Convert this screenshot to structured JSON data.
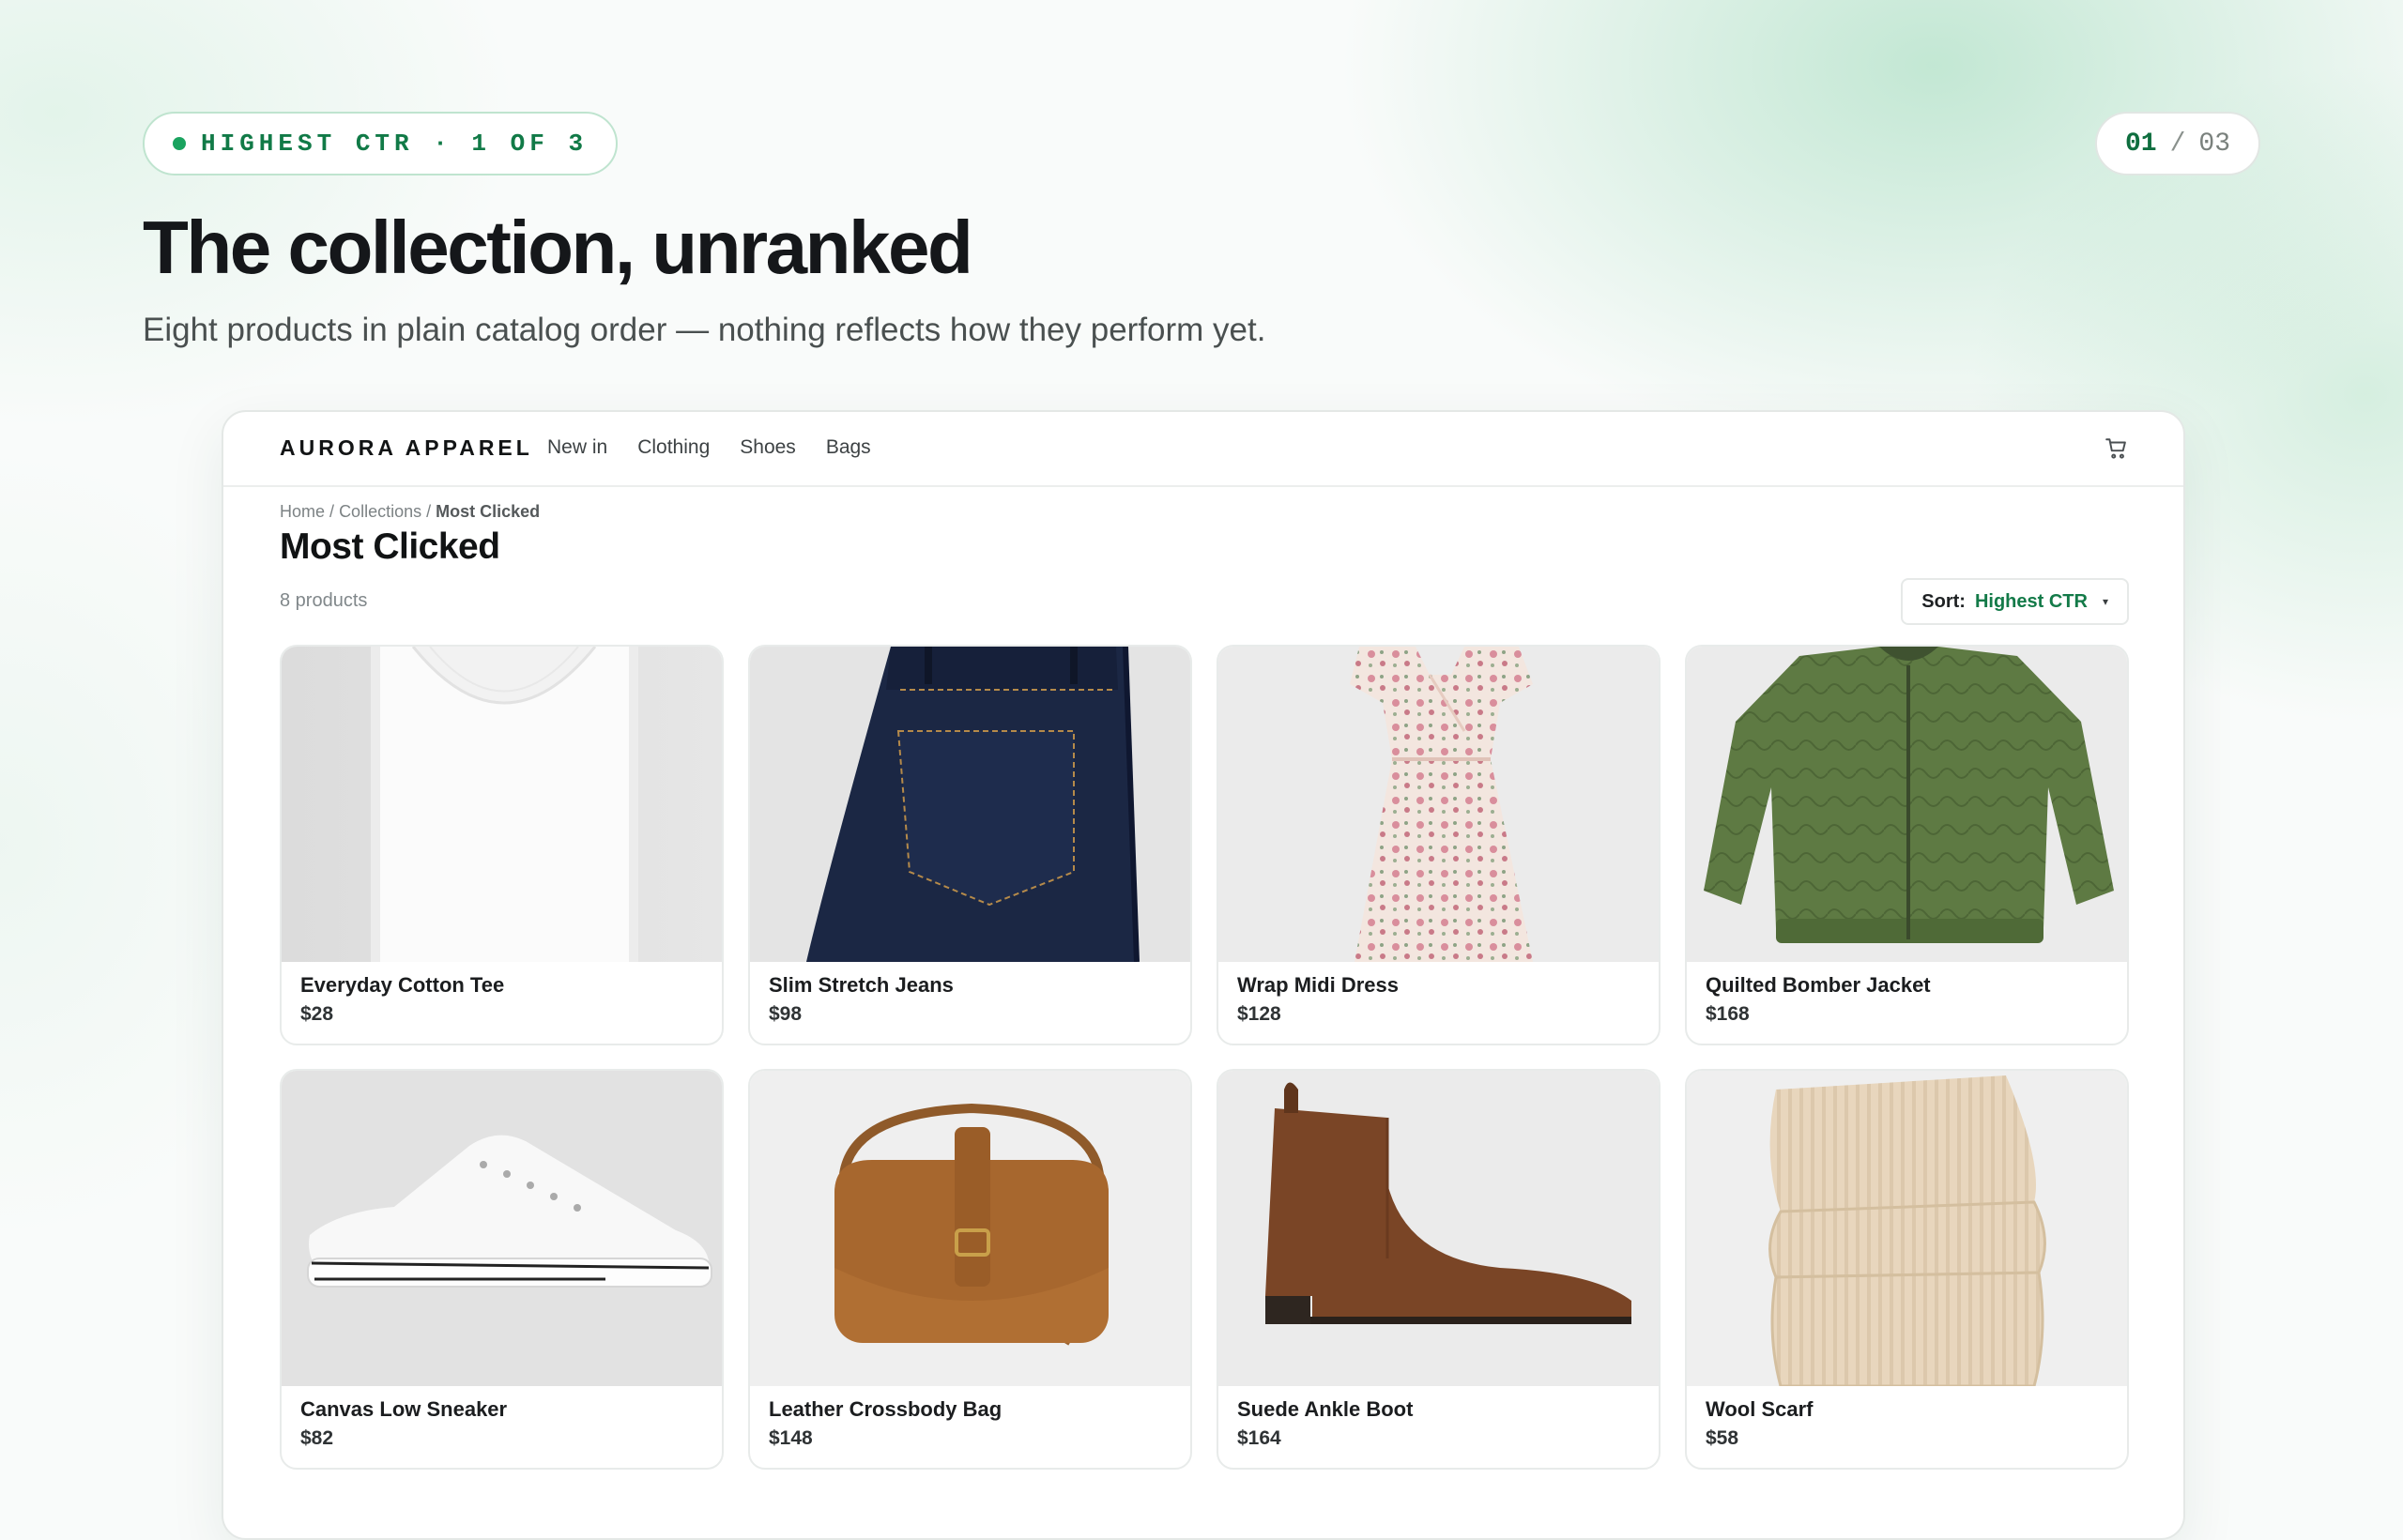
{
  "slide": {
    "pill_label": "HIGHEST CTR · 1 OF 3",
    "counter_current": "01",
    "counter_separator": "/",
    "counter_total": "03",
    "headline": "The collection, unranked",
    "subheadline": "Eight products in plain catalog order — nothing reflects how they perform yet."
  },
  "store": {
    "brand": "AURORA APPAREL",
    "nav": [
      "New in",
      "Clothing",
      "Shoes",
      "Bags"
    ],
    "cart_icon": "cart-icon",
    "breadcrumb": {
      "home": "Home",
      "sep1": "/",
      "collections": "Collections",
      "sep2": "/",
      "current": "Most Clicked"
    },
    "title": "Most Clicked",
    "count": "8 products",
    "sort": {
      "label": "Sort:",
      "value": "Highest CTR",
      "caret": "▾"
    },
    "products": [
      {
        "name": "Everyday Cotton Tee",
        "price": "$28"
      },
      {
        "name": "Slim Stretch Jeans",
        "price": "$98"
      },
      {
        "name": "Wrap Midi Dress",
        "price": "$128"
      },
      {
        "name": "Quilted Bomber Jacket",
        "price": "$168"
      },
      {
        "name": "Canvas Low Sneaker",
        "price": "$82"
      },
      {
        "name": "Leather Crossbody Bag",
        "price": "$148"
      },
      {
        "name": "Suede Ankle Boot",
        "price": "$164"
      },
      {
        "name": "Wool Scarf",
        "price": "$58"
      }
    ]
  },
  "colors": {
    "accent": "#137a48",
    "pill_border": "#bfe4cf",
    "text_dark": "#15171a"
  }
}
